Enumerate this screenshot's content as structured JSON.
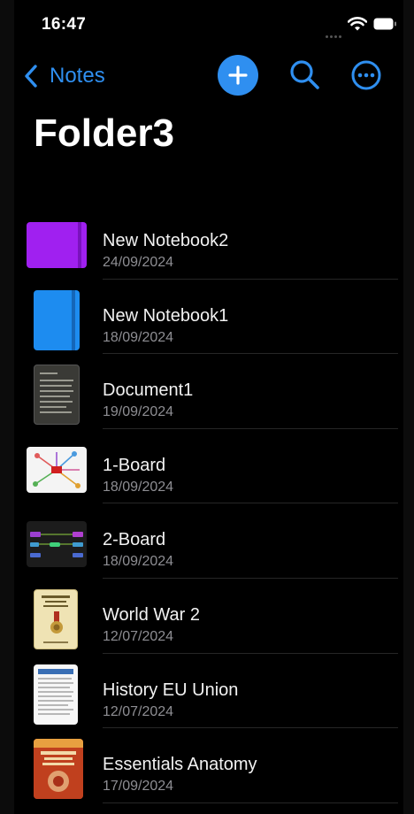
{
  "status": {
    "time": "16:47"
  },
  "nav": {
    "back_label": "Notes"
  },
  "page": {
    "title": "Folder3"
  },
  "items": [
    {
      "name": "New Notebook2",
      "date": "24/09/2024",
      "thumb_icon": "notebook-icon",
      "color": "#a020f0"
    },
    {
      "name": "New Notebook1",
      "date": "18/09/2024",
      "thumb_icon": "notebook-icon",
      "color": "#1d8cf0"
    },
    {
      "name": "Document1",
      "date": "19/09/2024",
      "thumb_icon": "document-thumbnail"
    },
    {
      "name": "1-Board",
      "date": "18/09/2024",
      "thumb_icon": "mindmap-thumbnail"
    },
    {
      "name": "2-Board",
      "date": "18/09/2024",
      "thumb_icon": "flowchart-thumbnail"
    },
    {
      "name": "World War 2",
      "date": "12/07/2024",
      "thumb_icon": "book-cover-thumbnail"
    },
    {
      "name": "History EU Union",
      "date": "12/07/2024",
      "thumb_icon": "document-thumbnail"
    },
    {
      "name": "Essentials Anatomy",
      "date": "17/09/2024",
      "thumb_icon": "book-cover-thumbnail"
    }
  ],
  "colors": {
    "accent": "#2f8ff0",
    "background": "#000000",
    "secondary_text": "#8e8e93"
  }
}
